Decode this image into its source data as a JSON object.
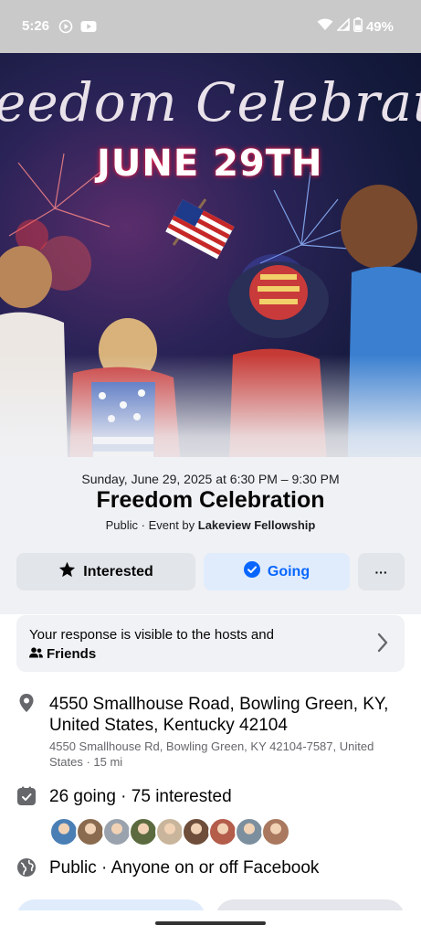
{
  "status_bar": {
    "time": "5:26",
    "battery": "49%",
    "left_icons": [
      "play-circle-icon",
      "youtube-icon"
    ],
    "right_icons": [
      "wifi-icon",
      "signal-icon",
      "battery-icon"
    ]
  },
  "cover": {
    "script_text": "eedom Celebrati",
    "date_text": "JUNE 29TH",
    "colors": {
      "date_glow": "#e11d48"
    }
  },
  "event": {
    "datetime": "Sunday, June 29, 2025 at 6:30 PM – 9:30 PM",
    "title": "Freedom Celebration",
    "meta_prefix": "Public · Event by ",
    "host": "Lakeview Fellowship"
  },
  "actions": {
    "interested_label": "Interested",
    "going_label": "Going",
    "more_label": "···"
  },
  "visibility": {
    "text": "Your response is visible to the hosts and",
    "audience": "Friends"
  },
  "location": {
    "primary": "4550 Smallhouse Road, Bowling Green, KY, United States, Kentucky 42104",
    "secondary": "4550 Smallhouse Rd, Bowling Green, KY 42104-7587, United States · 15 mi"
  },
  "attendance": {
    "summary": "26 going · 75 interested",
    "avatar_colors": [
      "#4a7fb5",
      "#8a6b4f",
      "#9aa3ad",
      "#5b6b3f",
      "#c9b59b",
      "#6e4e3a",
      "#b35d4a",
      "#7c8f9e",
      "#a9785e"
    ]
  },
  "privacy": {
    "text": "Public · Anyone on or off Facebook"
  },
  "colors": {
    "accent": "#0866ff",
    "secondary_text": "#65676b",
    "button_gray": "#e2e5e9",
    "going_bg": "#e0ecfc"
  }
}
